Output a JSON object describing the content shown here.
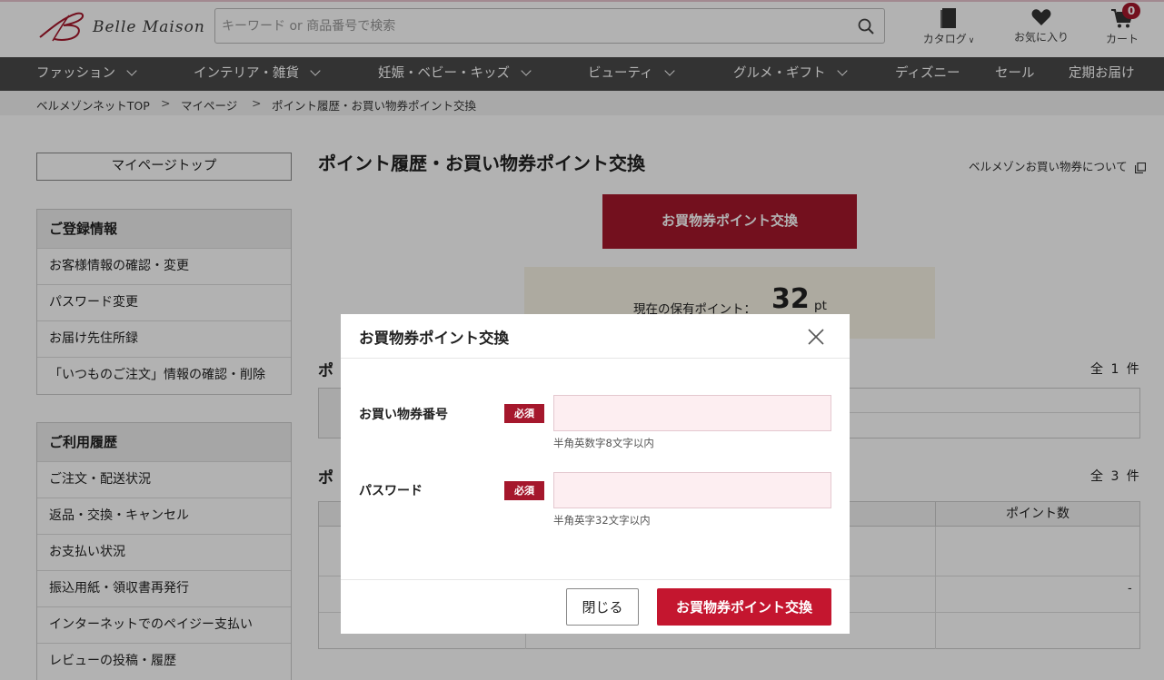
{
  "header": {
    "logo_text": "Belle Maison",
    "search_placeholder": "キーワード or 商品番号で検索",
    "catalog_label": "カタログ",
    "favorites_label": "お気に入り",
    "cart_label": "カート",
    "cart_count": "0"
  },
  "nav": {
    "items": [
      {
        "label": "ファッション",
        "has_dropdown": true
      },
      {
        "label": "インテリア・雑貨",
        "has_dropdown": true
      },
      {
        "label": "妊娠・ベビー・キッズ",
        "has_dropdown": true
      },
      {
        "label": "ビューティ",
        "has_dropdown": true
      },
      {
        "label": "グルメ・ギフト",
        "has_dropdown": true
      },
      {
        "label": "ディズニー",
        "has_dropdown": false
      },
      {
        "label": "セール",
        "has_dropdown": false
      },
      {
        "label": "定期お届け",
        "has_dropdown": false
      }
    ]
  },
  "breadcrumb": [
    "ベルメゾンネットTOP",
    "マイページ",
    "ポイント履歴・お買い物券ポイント交換"
  ],
  "sidebar": {
    "top_button": "マイページトップ",
    "groups": [
      {
        "title": "ご登録情報",
        "items": [
          "お客様情報の確認・変更",
          "パスワード変更",
          "お届け先住所録",
          "「いつものご注文」情報の確認・削除"
        ]
      },
      {
        "title": "ご利用履歴",
        "items": [
          "ご注文・配送状況",
          "返品・交換・キャンセル",
          "お支払い状況",
          "振込用紙・領収書再発行",
          "インターネットでのペイジー支払い",
          "レビューの投稿・履歴"
        ]
      }
    ]
  },
  "main": {
    "title": "ポイント履歴・お買い物券ポイント交換",
    "about_link": "ベルメゾンお買い物券について",
    "exchange_button": "お買物券ポイント交換",
    "points_label": "現在の保有ポイント：",
    "points_value": "32",
    "points_unit": "pt",
    "section1_title": "ポ",
    "section1_count": "全 1 件",
    "section2_title": "ポ",
    "section2_count": "全 3 件",
    "table_col_points": "ポイント数",
    "table_dash": "-"
  },
  "modal": {
    "title": "お買物券ポイント交換",
    "required_badge": "必須",
    "fields": [
      {
        "label": "お買い物券番号",
        "value": "",
        "placeholder": "",
        "hint": "半角英数字8文字以内"
      },
      {
        "label": "パスワード",
        "value": "",
        "placeholder": "",
        "hint": "半角英字32文字以内"
      }
    ],
    "close_button": "閉じる",
    "submit_button": "お買物券ポイント交換"
  },
  "colors": {
    "accent": "#a5172c",
    "submit": "#c4162f",
    "nav_bg": "#4a4a4a",
    "input_bg": "#fdeef1",
    "points_bg": "#f8f4e6"
  }
}
